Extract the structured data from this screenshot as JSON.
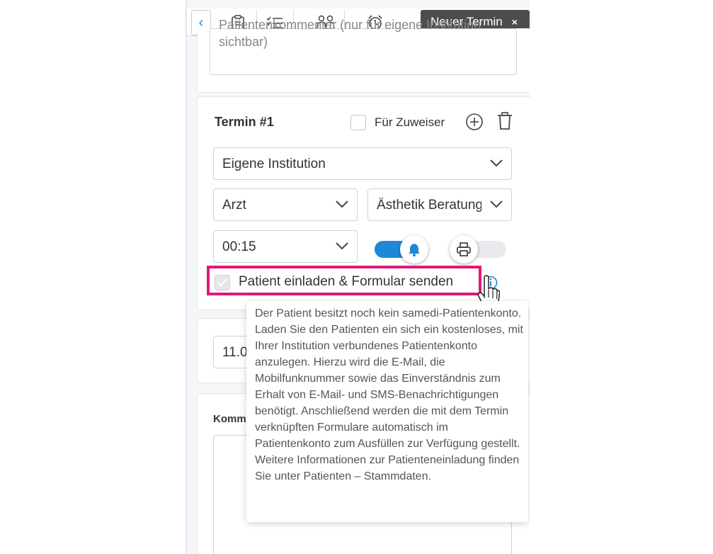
{
  "tabs": {
    "back_icon": "chevron-left-icon",
    "icons": [
      "clipboard-icon",
      "checklist-icon",
      "people-icon",
      "alarm-clock-icon"
    ],
    "active_label": "Neuer Termin",
    "close_label": "×"
  },
  "patient_comment": {
    "placeholder": "Patientenkommentar (nur für eigene Institution sichtbar)"
  },
  "appointment": {
    "title": "Termin #1",
    "for_referrer_label": "Für Zuweiser",
    "institution": "Eigene Institution",
    "role": "Arzt",
    "service": "Ästhetik Beratung",
    "duration": "00:15",
    "notify_toggle_on": true,
    "print_toggle_on": false,
    "invite_label": "Patient einladen & Formular senden"
  },
  "date_partial": "11.0",
  "comment_section_label": "Komm",
  "tooltip_text": "Der Patient besitzt noch kein samedi-Patientenkonto. Laden Sie den Patienten ein sich ein kostenloses, mit Ihrer Institution verbundenes Patientenkonto anzulegen. Hierzu wird die E-Mail, die Mobilfunknummer sowie das Einverständnis zum Erhalt von E-Mail- und SMS-Benachrichtigungen benötigt. Anschließend werden die mit dem Termin verknüpften Formulare automatisch im Patientenkonto zum Ausfüllen zur Verfügung gestellt. Weitere Informationen zur Patienteneinladung finden Sie unter Patienten – Stammdaten.",
  "colors": {
    "accent": "#1e88d8",
    "highlight": "#e0197d",
    "active_tab": "#4d4d4d"
  }
}
